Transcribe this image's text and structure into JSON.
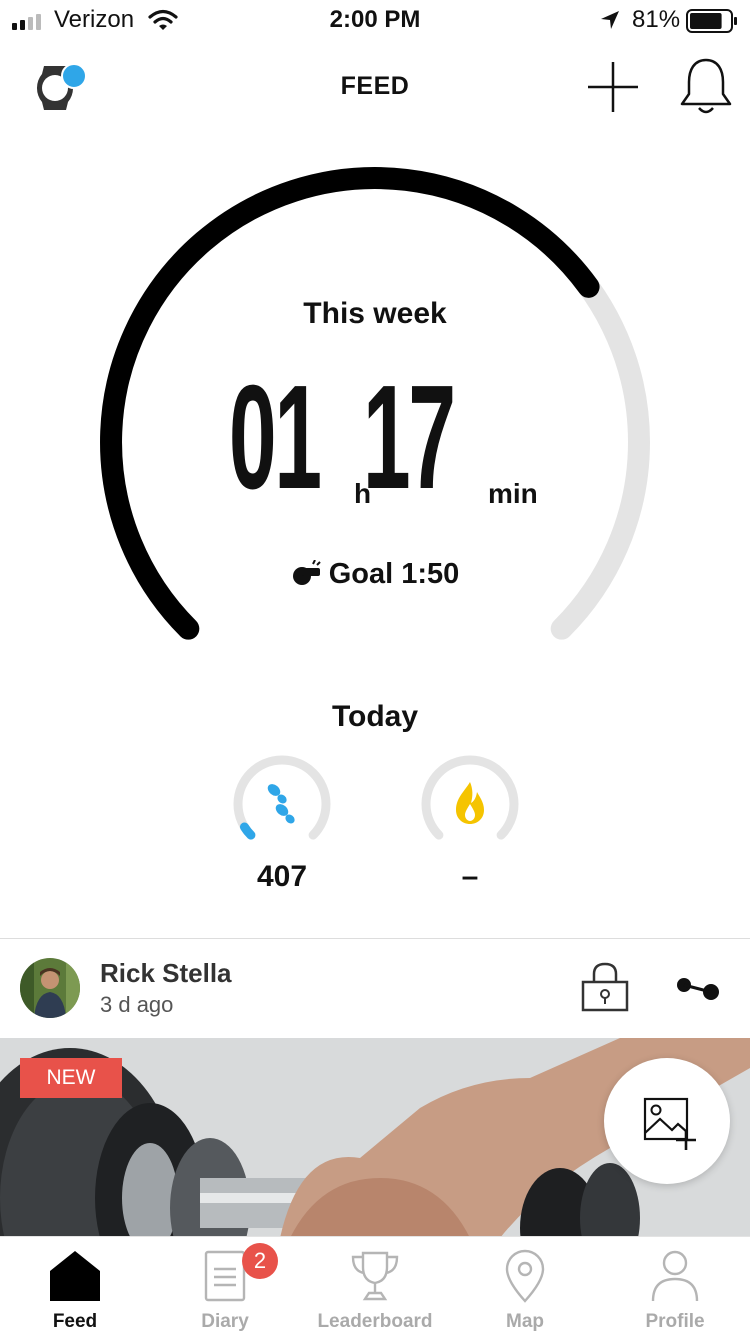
{
  "status_bar": {
    "carrier": "Verizon",
    "time": "2:00 PM",
    "battery_pct": "81%",
    "battery_level": 0.81
  },
  "header": {
    "title": "FEED",
    "icons": [
      "watch-icon",
      "plus-icon",
      "bell-icon"
    ]
  },
  "week": {
    "label": "This week",
    "hours": "01",
    "hours_unit": "h",
    "minutes": "17",
    "minutes_unit": "min",
    "goal_text": "Goal 1:50",
    "progress": 0.7
  },
  "today": {
    "label": "Today",
    "steps_value": "407",
    "steps_progress": 0.05,
    "calories_value": "–",
    "calories_progress": 0
  },
  "post": {
    "name": "Rick Stella",
    "time_ago": "3 d ago",
    "badge": "NEW"
  },
  "colors": {
    "accent_blue": "#2fa6e8",
    "badge_red": "#e8524a",
    "flame_yellow": "#f5c400",
    "ring_gray": "#e4e4e4"
  },
  "tabs": [
    {
      "label": "Feed",
      "icon": "home-icon",
      "active": true
    },
    {
      "label": "Diary",
      "icon": "diary-icon",
      "badge": "2"
    },
    {
      "label": "Leaderboard",
      "icon": "trophy-icon"
    },
    {
      "label": "Map",
      "icon": "map-pin-icon"
    },
    {
      "label": "Profile",
      "icon": "profile-icon"
    }
  ]
}
